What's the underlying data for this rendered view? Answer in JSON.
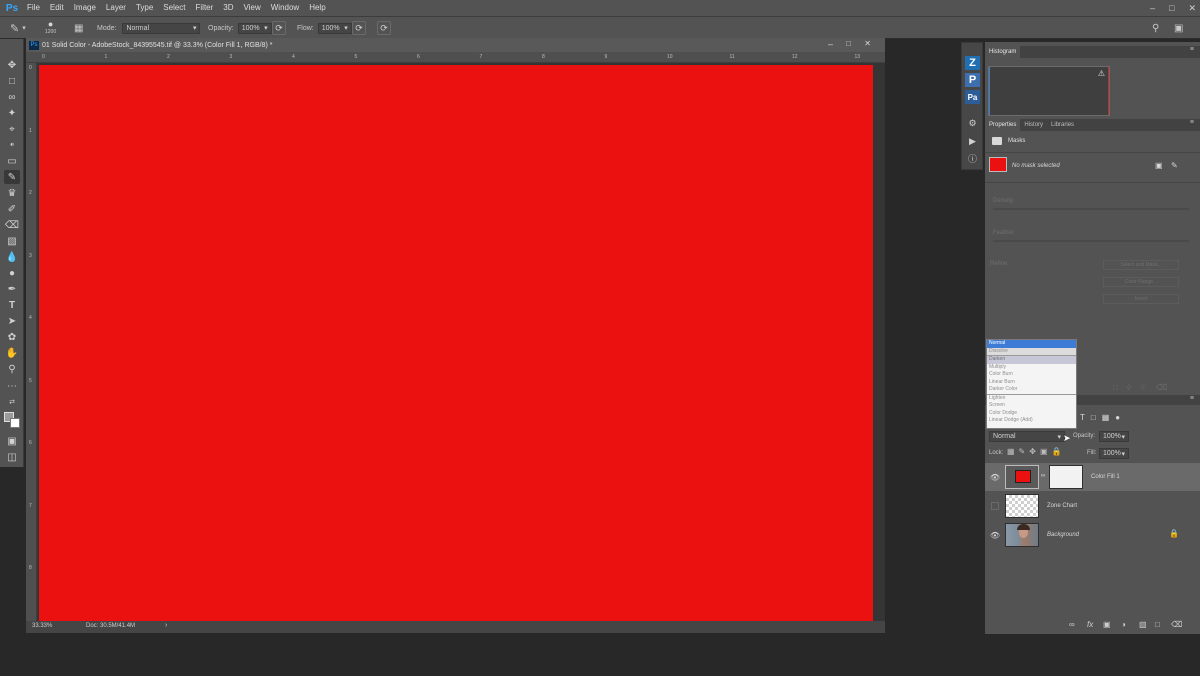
{
  "app": {
    "logo": "Ps"
  },
  "menu": [
    "File",
    "Edit",
    "Image",
    "Layer",
    "Type",
    "Select",
    "Filter",
    "3D",
    "View",
    "Window",
    "Help"
  ],
  "options": {
    "brush_size": "1200",
    "mode_label": "Mode:",
    "mode_value": "Normal",
    "opacity_label": "Opacity:",
    "opacity_value": "100%",
    "flow_label": "Flow:",
    "flow_value": "100%"
  },
  "document": {
    "title": "01 Solid Color - AdobeStock_84395545.tif @ 33.3% (Color Fill 1, RGB/8) *",
    "zoom": "33.33%",
    "doc_size": "Doc: 30.5M/41.4M",
    "canvas_color": "#ec1111",
    "ruler_top": [
      "0",
      "1",
      "2",
      "3",
      "4",
      "5",
      "6",
      "7",
      "8",
      "9",
      "10",
      "11",
      "12",
      "13"
    ],
    "ruler_left": [
      "0",
      "1",
      "2",
      "3",
      "4",
      "5",
      "6",
      "7",
      "8"
    ]
  },
  "histogram": {
    "tab": "Histogram"
  },
  "properties": {
    "tabs": [
      "Properties",
      "History",
      "Libraries"
    ],
    "section": "Masks",
    "mask_text": "No mask selected",
    "density": "Density:",
    "feather": "Feather:",
    "refine": "Refine:",
    "btn_select_mask": "Select and Mask...",
    "btn_color_range": "Color Range...",
    "btn_invert": "Invert"
  },
  "blend_list": [
    "Normal",
    "Dissolve",
    "Darken",
    "Multiply",
    "Color Burn",
    "Linear Burn",
    "Darker Color",
    "Lighten",
    "Screen",
    "Color Dodge",
    "Linear Dodge (Add)"
  ],
  "layers": {
    "blend_mode": "Normal",
    "opacity_label": "Opacity:",
    "opacity_value": "100%",
    "lock_label": "Lock:",
    "fill_label": "Fill:",
    "fill_value": "100%",
    "items": [
      {
        "name": "Color Fill 1"
      },
      {
        "name": "Zone Chart"
      },
      {
        "name": "Background"
      }
    ]
  },
  "colors": {
    "accent": "#31a8ff",
    "fill": "#ec1111"
  }
}
